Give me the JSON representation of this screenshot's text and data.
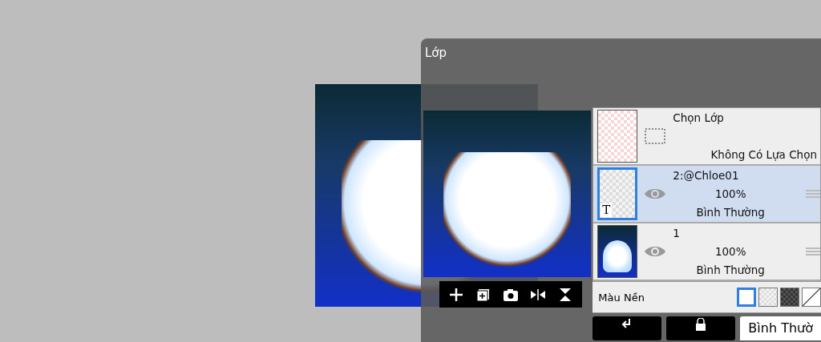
{
  "panel": {
    "title": "Lớp"
  },
  "preview_toolbar": [
    {
      "kind": "add"
    },
    {
      "kind": "add-layer"
    },
    {
      "kind": "camera"
    },
    {
      "kind": "flip-h"
    },
    {
      "kind": "flip-v"
    }
  ],
  "layers": [
    {
      "kind": "selection",
      "name": "Chọn Lớp",
      "status": "Không Có Lựa Chọn",
      "selected": false
    },
    {
      "kind": "text",
      "badge": "T",
      "name": "2:@Chloe01",
      "opacity": "100%",
      "blend": "Bình Thường",
      "visible": true,
      "selected": true
    },
    {
      "kind": "image",
      "name": "1",
      "opacity": "100%",
      "blend": "Bình Thường",
      "visible": true,
      "selected": false
    }
  ],
  "background": {
    "label": "Màu Nền",
    "swatches": [
      {
        "kind": "white",
        "selected": true
      },
      {
        "kind": "transparent",
        "selected": false
      },
      {
        "kind": "dark",
        "selected": false
      },
      {
        "kind": "none",
        "selected": false
      }
    ]
  },
  "bottom": {
    "buttons": [
      {
        "kind": "clip"
      },
      {
        "kind": "alpha-lock"
      }
    ],
    "blend_mode": "Bình Thườ"
  }
}
